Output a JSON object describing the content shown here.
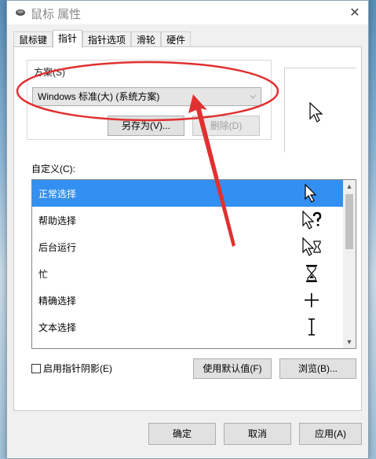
{
  "window": {
    "title": "鼠标 属性",
    "close_glyph": "✕"
  },
  "tabs": [
    {
      "label": "鼠标键"
    },
    {
      "label": "指针"
    },
    {
      "label": "指针选项"
    },
    {
      "label": "滑轮"
    },
    {
      "label": "硬件"
    }
  ],
  "scheme": {
    "label": "方案(S)",
    "selected": "Windows 标准(大) (系统方案)",
    "save_as": "另存为(V)...",
    "delete": "删除(D)"
  },
  "custom": {
    "label": "自定义(C):",
    "items": [
      {
        "label": "正常选择",
        "icon": "arrow-cursor-icon"
      },
      {
        "label": "帮助选择",
        "icon": "help-cursor-icon"
      },
      {
        "label": "后台运行",
        "icon": "working-cursor-icon"
      },
      {
        "label": "忙",
        "icon": "busy-cursor-icon"
      },
      {
        "label": "精确选择",
        "icon": "crosshair-cursor-icon"
      },
      {
        "label": "文本选择",
        "icon": "text-cursor-icon"
      }
    ]
  },
  "options": {
    "shadow_label": "启用指针阴影(E)",
    "shadow_checked": false,
    "use_default": "使用默认值(F)",
    "browse": "浏览(B)..."
  },
  "footer": {
    "ok": "确定",
    "cancel": "取消",
    "apply": "应用(A)"
  },
  "colors": {
    "selection": "#3390f0",
    "annotation": "#e03030"
  }
}
